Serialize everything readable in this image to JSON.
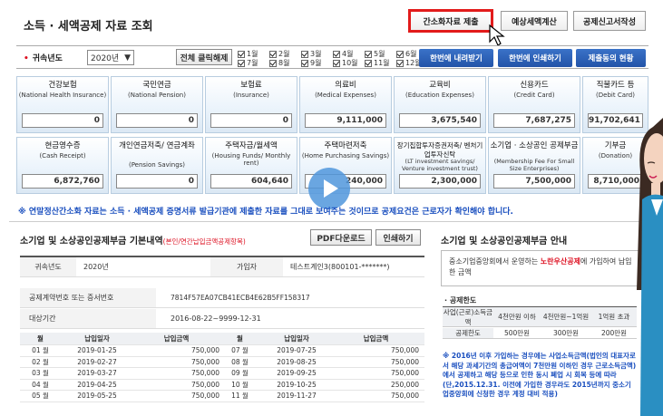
{
  "header": {
    "title": "소득 · 세액공제 자료 조회",
    "buttons": [
      "간소화자료 제출",
      "예상세액계산",
      "공제신고서작성"
    ]
  },
  "filter": {
    "label": "귀속년도",
    "year": "2020년",
    "clear_all": "전체 클릭해제",
    "months": [
      "1월",
      "2월",
      "3월",
      "4월",
      "5월",
      "6월",
      "7월",
      "8월",
      "9월",
      "10월",
      "11월",
      "12월"
    ],
    "actions": [
      "한번에 내려받기",
      "한번에 인쇄하기",
      "제출동의 현황"
    ]
  },
  "cards": [
    {
      "title": "건강보험",
      "sub": "(National Health Insurance)",
      "value": "0"
    },
    {
      "title": "국민연금",
      "sub": "(National Pension)",
      "value": "0"
    },
    {
      "title": "보험료",
      "sub": "(Insurance)",
      "value": "0"
    },
    {
      "title": "의료비",
      "sub": "(Medical Expenses)",
      "value": "9,111,000"
    },
    {
      "title": "교육비",
      "sub": "(Education Expenses)",
      "value": "3,675,540"
    },
    {
      "title": "신용카드",
      "sub": "(Credit Card)",
      "value": "7,687,275"
    },
    {
      "title": "직불카드 등",
      "sub": "(Debit Card)",
      "value": "91,702,641"
    },
    {
      "title": "현금영수증",
      "sub": "(Cash Receipt)",
      "value": "6,872,760"
    },
    {
      "title": "개인연금저축/ 연금계좌",
      "sub": "(Pension Savings)",
      "value": "0"
    },
    {
      "title": "주택자금/월세액",
      "sub": "(Housing Funds/ Monthly rent)",
      "value": "604,640"
    },
    {
      "title": "주택마련저축",
      "sub": "(Home Purchasing Savings)",
      "value": "240,000"
    },
    {
      "title": "장기집합투자증권저축/ 벤처기업투자신탁",
      "sub": "(LT investment savings/ Venture investment trust)",
      "value": "2,300,000"
    },
    {
      "title": "소기업 · 소상공인 공제부금",
      "sub": "(Membership Fee For Small Size Enterprises)",
      "value": "7,500,000"
    },
    {
      "title": "기부금",
      "sub": "(Donation)",
      "value": "8,710,000"
    }
  ],
  "notice": "※ 연말정산간소화 자료는 소득 · 세액공제 증명서류 발급기관에 제출한 자료를 그대로 보여주는 것이므로 공제요건은 근로자가 확인해야 합니다.",
  "basic": {
    "title": "소기업 및 소상공인공제부금 기본내역",
    "title_note": "(본인/연간납입금액공제항목)",
    "pdf": "PDF다운로드",
    "print": "인쇄하기",
    "year_label": "귀속년도",
    "year_value": "2020년",
    "member_label": "가입자",
    "member_value": "테스트계인3(800101-*******)",
    "contract_label": "공제계약번호 또는 증서번호",
    "contract_value": "7814F57EA07CB41ECB4E62B5FF158317",
    "period_label": "대상기간",
    "period_value": "2016-08-22~9999-12-31"
  },
  "payments": {
    "headers": [
      "월",
      "납입일자",
      "납입금액",
      "월",
      "납입일자",
      "납입금액"
    ],
    "rows": [
      [
        "01 월",
        "2019-01-25",
        "750,000",
        "07 월",
        "2019-07-25",
        "750,000"
      ],
      [
        "02 월",
        "2019-02-27",
        "750,000",
        "08 월",
        "2019-08-25",
        "750,000"
      ],
      [
        "03 월",
        "2019-03-27",
        "750,000",
        "09 월",
        "2019-09-25",
        "750,000"
      ],
      [
        "04 월",
        "2019-04-25",
        "750,000",
        "10 월",
        "2019-10-25",
        "250,000"
      ],
      [
        "05 월",
        "2019-05-25",
        "750,000",
        "11 월",
        "2019-11-27",
        "750,000"
      ]
    ]
  },
  "guide": {
    "title": "소기업 및 소상공인공제부금 안내",
    "intro_a": "중소기업중앙회에서 운영하는 ",
    "intro_hl": "노란우산공제",
    "intro_b": "에 가입하여 납입한 금액",
    "limit_title": "· 공제한도",
    "limit_headers": [
      "사업(근로)소득금액",
      "4천만원 이하",
      "4천만원~1억원",
      "1억원 초과"
    ],
    "limit_values": [
      "공제한도",
      "500만원",
      "300만원",
      "200만원"
    ],
    "footnote": "※ 2016년 이후 가입하는 경우에는 사업소득금액(법인의 대표자로서 해당 과세기간의 총급여액이 7천만원 이하인 경우 근로소득금액)에서 공제하고 해당 등으로 인한 동시 폐업 시 회복 등에 따라 (단,2015.12.31. 이전에 가입한 경우라도 2015년까지 중소기업중앙회에 신청한 경우 계정 대비 적용)"
  }
}
